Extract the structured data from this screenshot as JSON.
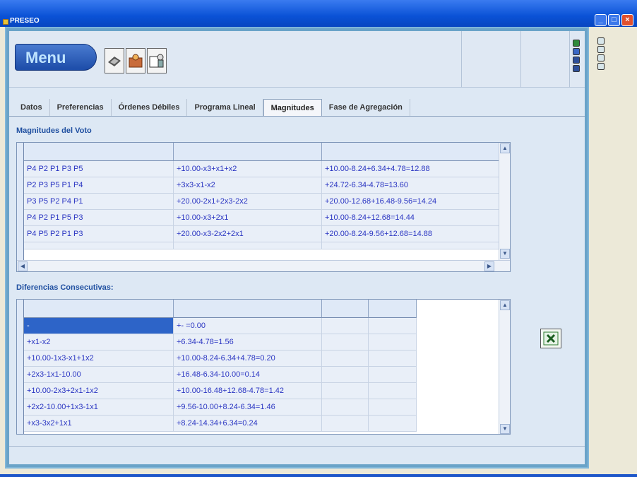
{
  "window": {
    "title": "PRESEO"
  },
  "toolbar": {
    "menu_label": "Menu"
  },
  "tabs": [
    {
      "label": "Datos"
    },
    {
      "label": "Preferencias"
    },
    {
      "label": "Órdenes Débiles"
    },
    {
      "label": "Programa Lineal"
    },
    {
      "label": "Magnitudes"
    },
    {
      "label": "Fase de Agregación"
    }
  ],
  "active_tab": "Magnitudes",
  "magnitudes": {
    "title": "Magnitudes del Voto",
    "rows": [
      [
        "P4 P2 P1 P3 P5",
        "+10.00-x3+x1+x2",
        "+10.00-8.24+6.34+4.78=12.88"
      ],
      [
        "P2 P3 P5 P1 P4",
        "+3x3-x1-x2",
        "+24.72-6.34-4.78=13.60"
      ],
      [
        "P3 P5 P2 P4 P1",
        "+20.00-2x1+2x3-2x2",
        "+20.00-12.68+16.48-9.56=14.24"
      ],
      [
        "P4 P2 P1 P5 P3",
        "+10.00-x3+2x1",
        "+10.00-8.24+12.68=14.44"
      ],
      [
        "P4 P5 P2 P1 P3",
        "+20.00-x3-2x2+2x1",
        "+20.00-8.24-9.56+12.68=14.88"
      ]
    ]
  },
  "diferencias": {
    "title": "Diferencias Consecutivas:",
    "rows": [
      [
        "-",
        "+- =0.00"
      ],
      [
        "+x1-x2",
        "+6.34-4.78=1.56"
      ],
      [
        "+10.00-1x3-x1+1x2",
        "+10.00-8.24-6.34+4.78=0.20"
      ],
      [
        "+2x3-1x1-10.00",
        "+16.48-6.34-10.00=0.14"
      ],
      [
        "+10.00-2x3+2x1-1x2",
        "+10.00-16.48+12.68-4.78=1.42"
      ],
      [
        "+2x2-10.00+1x3-1x1",
        "+9.56-10.00+8.24-6.34=1.46"
      ],
      [
        "+x3-3x2+1x1",
        "+8.24-14.34+6.34=0.24"
      ]
    ]
  },
  "colors": {
    "accent": "#2d64c8",
    "cell_text": "#2a35c2",
    "label": "#1f4fa0"
  }
}
